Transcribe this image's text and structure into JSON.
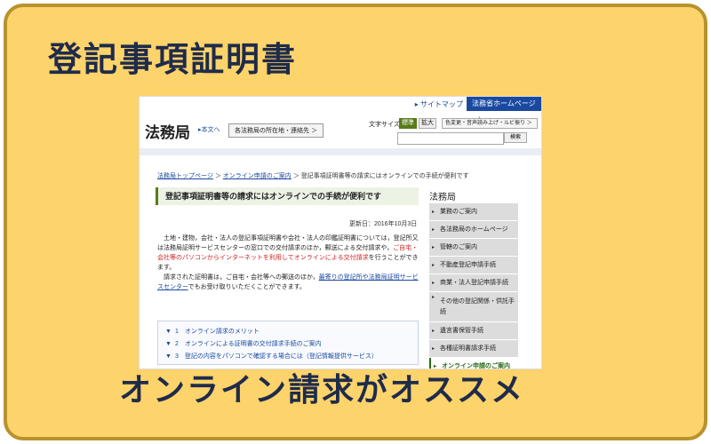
{
  "card": {
    "headline": "登記事項証明書",
    "footer": "オンライン請求がオススメ"
  },
  "site": {
    "sitemap": "サイトマップ",
    "home_button": "法務省ホームページ",
    "logo": "法務局",
    "honbun": "本文へ",
    "location_button": "各法務局の所在地・連絡先 ＞",
    "fontsize_label": "文字サイズ",
    "fontsize_standard": "標準",
    "fontsize_large": "拡大",
    "color_button": "色変更・音声読み上げ・ルビ振り ＞",
    "search_button": "検索"
  },
  "breadcrumb": {
    "item1": "法務局トップページ",
    "sep": "＞",
    "item2": "オンライン申請のご案内",
    "item3": "登記事項証明書等の請求にはオンラインでの手続が便利です"
  },
  "main": {
    "title": "登記事項証明書等の請求にはオンラインでの手続が便利です",
    "updated": "更新日：2016年10月3日",
    "p1a": "　土地・建物，会社・法人の登記事項証明書や会社・法人の印鑑証明書については，登記所又は法務局証明サービスセンターの窓口での交付請求のほか，郵送による交付請求や，",
    "p1red": "ご自宅・会社等のパソコンからインターネットを利用してオンラインによる交付請求",
    "p1b": "を行うことができます。",
    "p2a": "　請求された証明書は，ご自宅・会社等への郵送のほか，",
    "p2link": "最寄りの登記所や法務局証明サービスセンター",
    "p2b": "でもお受け取りいただくことができます。",
    "toc": [
      "1　オンライン請求のメリット",
      "2　オンラインによる証明書の交付請求手続のご案内",
      "3　登記の内容をパソコンで確認する場合には（登記情報提供サービス）"
    ]
  },
  "sidebar": {
    "title": "法務局",
    "items": [
      "業務のご案内",
      "各法務局のホームページ",
      "管轄のご案内",
      "不動産登記申請手続",
      "商業・法人登記申請手続",
      "その他の登記関係・供託手続",
      "遺言書保管手続",
      "各種証明書請求手続",
      "オンライン申請のご案内"
    ]
  }
}
